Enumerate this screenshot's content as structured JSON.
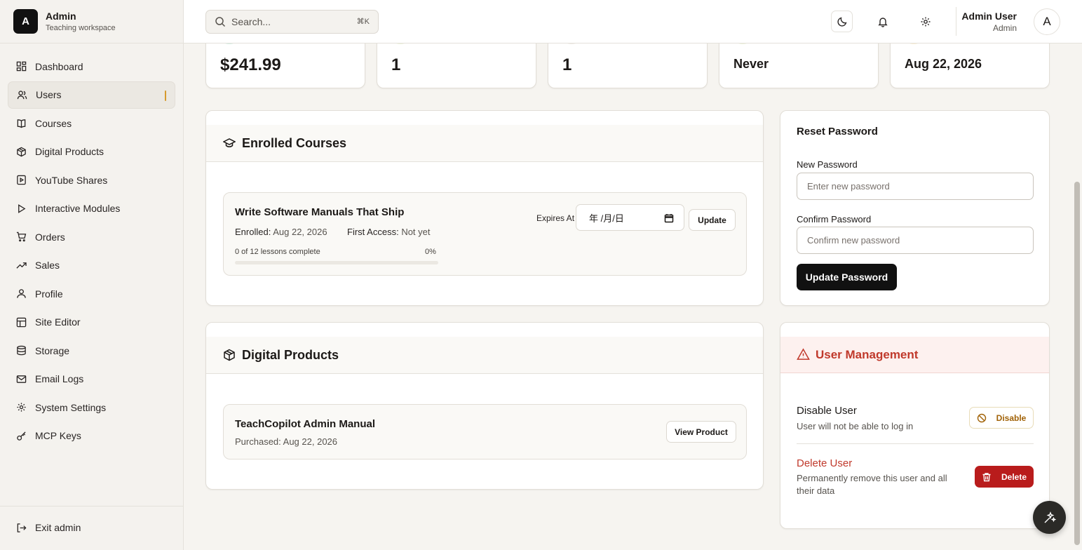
{
  "brand": {
    "logo_letter": "A",
    "name": "Admin",
    "subtitle": "Teaching workspace"
  },
  "sidebar": {
    "items": [
      {
        "label": "Dashboard",
        "icon": "dashboard-icon",
        "active": false
      },
      {
        "label": "Users",
        "icon": "users-icon",
        "active": true
      },
      {
        "label": "Courses",
        "icon": "book-icon",
        "active": false
      },
      {
        "label": "Digital Products",
        "icon": "package-icon",
        "active": false
      },
      {
        "label": "YouTube Shares",
        "icon": "youtube-icon",
        "active": false
      },
      {
        "label": "Interactive Modules",
        "icon": "play-icon",
        "active": false
      },
      {
        "label": "Orders",
        "icon": "cart-icon",
        "active": false
      },
      {
        "label": "Sales",
        "icon": "trending-up-icon",
        "active": false
      },
      {
        "label": "Profile",
        "icon": "user-icon",
        "active": false
      },
      {
        "label": "Site Editor",
        "icon": "layout-icon",
        "active": false
      },
      {
        "label": "Storage",
        "icon": "database-icon",
        "active": false
      },
      {
        "label": "Email Logs",
        "icon": "mail-icon",
        "active": false
      },
      {
        "label": "System Settings",
        "icon": "gear-icon",
        "active": false
      },
      {
        "label": "MCP Keys",
        "icon": "key-icon",
        "active": false
      }
    ],
    "exit_label": "Exit admin"
  },
  "topbar": {
    "search_placeholder": "Search...",
    "search_shortcut": "⌘K",
    "user_name": "Admin User",
    "user_role": "Admin",
    "avatar_letter": "A"
  },
  "stats": [
    {
      "value": "$241.99",
      "accent": "#d7f0e4"
    },
    {
      "value": "1",
      "accent": "#eef3dc"
    },
    {
      "value": "1",
      "accent": "#efece6"
    },
    {
      "value": "Never",
      "accent": "#eef3dc"
    },
    {
      "value": "Aug 22, 2026",
      "accent": "#fbf0d6"
    }
  ],
  "enrolled": {
    "title": "Enrolled Courses",
    "course": {
      "title": "Write Software Manuals That Ship",
      "enrolled_label": "Enrolled:",
      "enrolled_value": "Aug 22, 2026",
      "first_access_label": "First Access:",
      "first_access_value": "Not yet",
      "progress_text": "0 of 12 lessons complete",
      "progress_pct_text": "0%",
      "progress_fraction": 0,
      "expires_label": "Expires At",
      "date_placeholder": "年 /月/日",
      "update_label": "Update"
    }
  },
  "products": {
    "title": "Digital Products",
    "item": {
      "title": "TeachCopilot Admin Manual",
      "purchased": "Purchased: Aug 22, 2026",
      "button_label": "View Product"
    }
  },
  "reset_password": {
    "title": "Reset Password",
    "new_label": "New Password",
    "new_placeholder": "Enter new password",
    "confirm_label": "Confirm Password",
    "confirm_placeholder": "Confirm new password",
    "button_label": "Update Password"
  },
  "user_management": {
    "title": "User Management",
    "disable_title": "Disable User",
    "disable_desc": "User will not be able to log in",
    "disable_button": "Disable",
    "delete_title": "Delete User",
    "delete_desc": "Permanently remove this user and all their data",
    "delete_button": "Delete"
  }
}
